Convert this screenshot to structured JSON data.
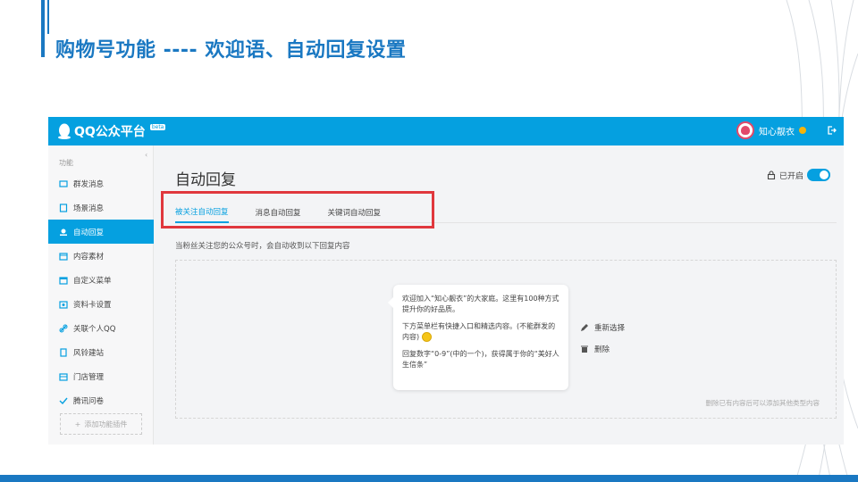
{
  "slide": {
    "title": "购物号功能 ----  欢迎语、自动回复设置"
  },
  "colors": {
    "brand": "#1a78c2",
    "app_accent": "#05a0e0",
    "highlight": "#e0373d"
  },
  "app": {
    "logo_text": "QQ公众平台",
    "beta": "beta",
    "user_name": "知心靓衣"
  },
  "sidebar": {
    "heading": "功能",
    "items": [
      {
        "label": "群发消息",
        "icon": "broadcast-icon"
      },
      {
        "label": "场景消息",
        "icon": "scene-icon"
      },
      {
        "label": "自动回复",
        "icon": "auto-reply-icon",
        "active": true
      },
      {
        "label": "内容素材",
        "icon": "material-icon"
      },
      {
        "label": "自定义菜单",
        "icon": "menu-icon"
      },
      {
        "label": "资料卡设置",
        "icon": "profile-card-icon"
      },
      {
        "label": "关联个人QQ",
        "icon": "link-icon"
      },
      {
        "label": "风铃建站",
        "icon": "site-icon"
      },
      {
        "label": "门店管理",
        "icon": "store-icon"
      },
      {
        "label": "腾讯问卷",
        "icon": "survey-icon"
      }
    ],
    "add_plugin": "添加功能插件"
  },
  "main": {
    "title": "自动回复",
    "toggle_label": "已开启",
    "tabs": [
      {
        "label": "被关注自动回复",
        "active": true
      },
      {
        "label": "消息自动回复"
      },
      {
        "label": "关键词自动回复"
      }
    ],
    "description": "当粉丝关注您的公众号时，会自动收到以下回复内容",
    "bubble": {
      "p1": "欢迎加入“知心靓衣”的大家庭。这里有100种方式提升你的好品质。",
      "p2": "下方菜单栏有快捷入口和精选内容。(不能群发的内容)",
      "p3": "回复数字“0-9”(中的一个)，获得属于你的“美好人生信条”"
    },
    "reselect": "重新选择",
    "delete": "删除",
    "hint": "删除已有内容后可以添加其他类型内容"
  }
}
